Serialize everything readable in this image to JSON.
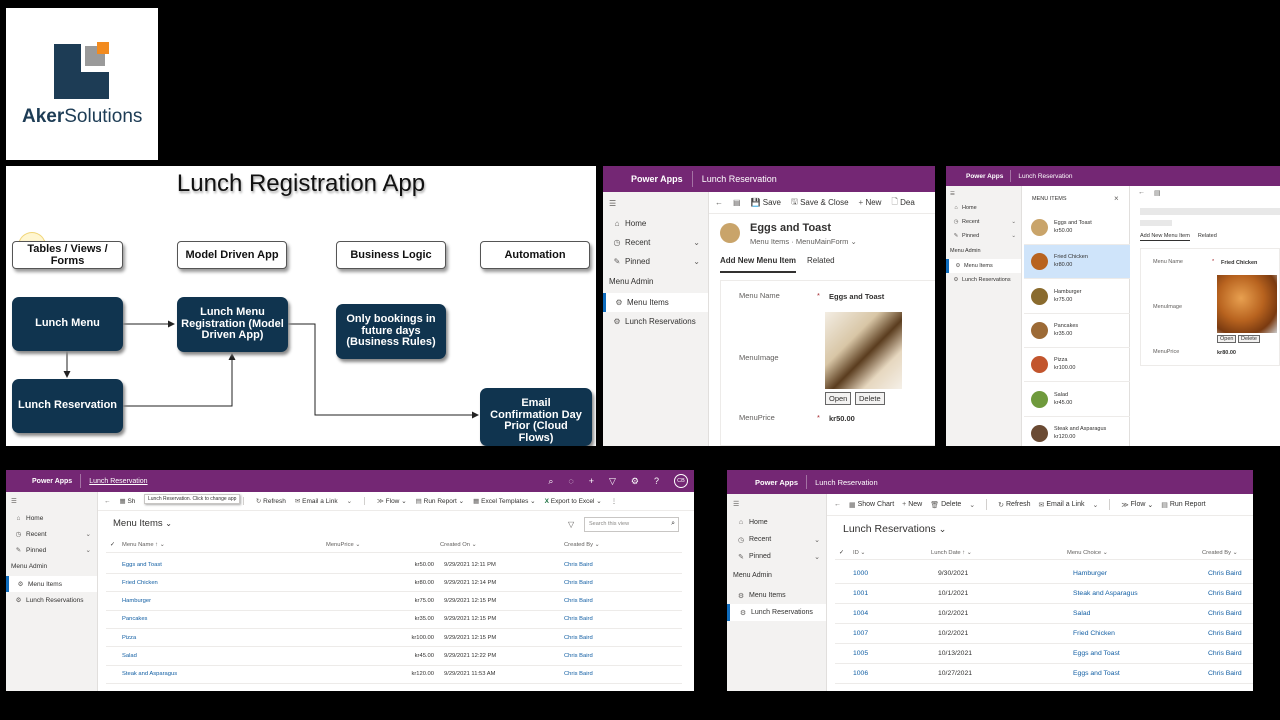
{
  "logo": {
    "word1": "Aker",
    "word2": "Solutions"
  },
  "flowchart": {
    "title": "Lunch Registration App",
    "headers": [
      "Tables / Views / Forms",
      "Model Driven App",
      "Business Logic",
      "Automation"
    ],
    "nodes": {
      "lunch_menu": "Lunch Menu",
      "lunch_reservation": "Lunch Reservation",
      "registration": "Lunch Menu Registration (Model Driven App)",
      "bookings": "Only bookings in future days (Business Rules)",
      "email": "Email Confirmation Day Prior (Cloud Flows)"
    }
  },
  "form_panel": {
    "brand": "Power Apps",
    "app_name": "Lunch Reservation",
    "nav": {
      "home": "Home",
      "recent": "Recent",
      "pinned": "Pinned",
      "group": "Menu Admin",
      "menu_items": "Menu Items",
      "lunch_reservations": "Lunch Reservations"
    },
    "commands": {
      "save": "Save",
      "save_close": "Save & Close",
      "new": "New",
      "deactivate": "Dea"
    },
    "record_title": "Eggs and Toast",
    "entity": "Menu Items",
    "form_name": "MenuMainForm",
    "tabs": {
      "add": "Add New Menu Item",
      "related": "Related"
    },
    "fields": {
      "name_label": "Menu Name",
      "name_value": "Eggs and Toast",
      "image_label": "MenuImage",
      "price_label": "MenuPrice",
      "price_value": "kr50.00",
      "required": "*"
    },
    "image_buttons": {
      "open": "Open",
      "delete": "Delete"
    }
  },
  "list_panel": {
    "brand": "Power Apps",
    "app_name": "Lunch Reservation",
    "nav": {
      "home": "Home",
      "recent": "Recent",
      "pinned": "Pinned",
      "group": "Menu Admin",
      "menu_items": "Menu Items",
      "lunch_reservations": "Lunch Reservations"
    },
    "list_title": "MENU ITEMS",
    "items": [
      {
        "name": "Eggs and Toast",
        "price": "kr50.00",
        "color": "#c9a46a"
      },
      {
        "name": "Fried Chicken",
        "price": "kr80.00",
        "color": "#b8631f"
      },
      {
        "name": "Hamburger",
        "price": "kr75.00",
        "color": "#8a6b2e"
      },
      {
        "name": "Pancakes",
        "price": "kr35.00",
        "color": "#9c6a36"
      },
      {
        "name": "Pizza",
        "price": "kr100.00",
        "color": "#c2552d"
      },
      {
        "name": "Salad",
        "price": "kr45.00",
        "color": "#6f9a3c"
      },
      {
        "name": "Steak and Asparagus",
        "price": "kr120.00",
        "color": "#6a4a33"
      }
    ],
    "tabs": {
      "add": "Add New Menu Item",
      "related": "Related"
    },
    "fields": {
      "name_label": "Menu Name",
      "name_value": "Fried Chicken",
      "image_label": "MenuImage",
      "price_label": "MenuPrice",
      "price_value": "kr80.00",
      "required": "*"
    },
    "image_buttons": {
      "open": "Open",
      "delete": "Delete"
    }
  },
  "grid_panel": {
    "brand": "Power Apps",
    "app_name": "Lunch Reservation",
    "tooltip": "Lunch Reservation. Click to change app",
    "user_initials": "CB",
    "nav": {
      "home": "Home",
      "recent": "Recent",
      "pinned": "Pinned",
      "group": "Menu Admin",
      "menu_items": "Menu Items",
      "lunch_reservations": "Lunch Reservations"
    },
    "commands": {
      "show": "Sh",
      "refresh": "Refresh",
      "email": "Email a Link",
      "flow": "Flow",
      "report": "Run Report",
      "templates": "Excel Templates",
      "export": "Export to Excel"
    },
    "view_title": "Menu Items",
    "search_placeholder": "Search this view",
    "columns": {
      "name": "Menu Name ↑",
      "price": "MenuPrice",
      "created_on": "Created On",
      "created_by": "Created By"
    },
    "rows": [
      {
        "name": "Eggs and Toast",
        "price": "kr50.00",
        "date": "9/29/2021 12:11 PM",
        "by": "Chris Baird"
      },
      {
        "name": "Fried Chicken",
        "price": "kr80.00",
        "date": "9/29/2021 12:14 PM",
        "by": "Chris Baird"
      },
      {
        "name": "Hamburger",
        "price": "kr75.00",
        "date": "9/29/2021 12:15 PM",
        "by": "Chris Baird"
      },
      {
        "name": "Pancakes",
        "price": "kr35.00",
        "date": "9/29/2021 12:15 PM",
        "by": "Chris Baird"
      },
      {
        "name": "Pizza",
        "price": "kr100.00",
        "date": "9/29/2021 12:15 PM",
        "by": "Chris Baird"
      },
      {
        "name": "Salad",
        "price": "kr45.00",
        "date": "9/29/2021 12:22 PM",
        "by": "Chris Baird"
      },
      {
        "name": "Steak and Asparagus",
        "price": "kr120.00",
        "date": "9/29/2021 11:53 AM",
        "by": "Chris Baird"
      }
    ]
  },
  "res_panel": {
    "brand": "Power Apps",
    "app_name": "Lunch Reservation",
    "nav": {
      "home": "Home",
      "recent": "Recent",
      "pinned": "Pinned",
      "group": "Menu Admin",
      "menu_items": "Menu Items",
      "lunch_reservations": "Lunch Reservations"
    },
    "commands": {
      "chart": "Show Chart",
      "new": "New",
      "delete": "Delete",
      "refresh": "Refresh",
      "email": "Email a Link",
      "flow": "Flow",
      "report": "Run Report"
    },
    "view_title": "Lunch Reservations",
    "columns": {
      "id": "ID",
      "date": "Lunch Date ↑",
      "choice": "Menu Choice",
      "by": "Created By"
    },
    "rows": [
      {
        "id": "1000",
        "date": "9/30/2021",
        "choice": "Hamburger",
        "by": "Chris Baird"
      },
      {
        "id": "1001",
        "date": "10/1/2021",
        "choice": "Steak and Asparagus",
        "by": "Chris Baird"
      },
      {
        "id": "1004",
        "date": "10/2/2021",
        "choice": "Salad",
        "by": "Chris Baird"
      },
      {
        "id": "1007",
        "date": "10/2/2021",
        "choice": "Fried Chicken",
        "by": "Chris Baird"
      },
      {
        "id": "1005",
        "date": "10/13/2021",
        "choice": "Eggs and Toast",
        "by": "Chris Baird"
      },
      {
        "id": "1006",
        "date": "10/27/2021",
        "choice": "Eggs and Toast",
        "by": "Chris Baird"
      }
    ]
  },
  "colors": {
    "power_apps_purple": "#742774",
    "flow_node": "#10344f",
    "logo_navy": "#1d3c55",
    "logo_orange": "#f28b1f",
    "link": "#115ea3"
  }
}
